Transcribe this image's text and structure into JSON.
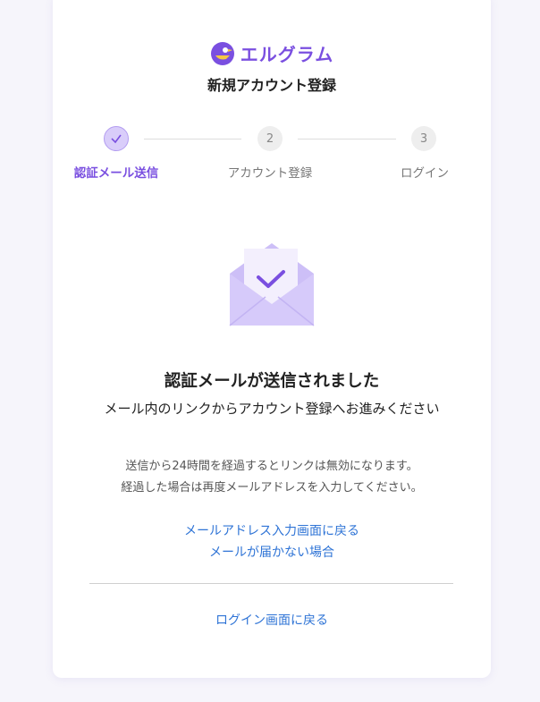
{
  "brand": {
    "name": "エルグラム",
    "color": "#7a4fe0"
  },
  "header": {
    "title": "新規アカウント登録"
  },
  "stepper": {
    "current": 1,
    "steps": [
      {
        "number": "",
        "label": "認証メール送信",
        "state": "done"
      },
      {
        "number": "2",
        "label": "アカウント登録",
        "state": "pending"
      },
      {
        "number": "3",
        "label": "ログイン",
        "state": "pending"
      }
    ]
  },
  "main": {
    "headline": "認証メールが送信されました",
    "subhead": "メール内のリンクからアカウント登録へお進みください",
    "notice_line1": "送信から24時間を経過するとリンクは無効になります。",
    "notice_line2": "経過した場合は再度メールアドレスを入力してください。"
  },
  "links": {
    "back_to_email": "メールアドレス入力画面に戻る",
    "not_received": "メールが届かない場合",
    "back_to_login": "ログイン画面に戻る"
  },
  "colors": {
    "accent": "#7a4fe0",
    "link": "#2f74d6",
    "envelope": "#cdbff7"
  }
}
